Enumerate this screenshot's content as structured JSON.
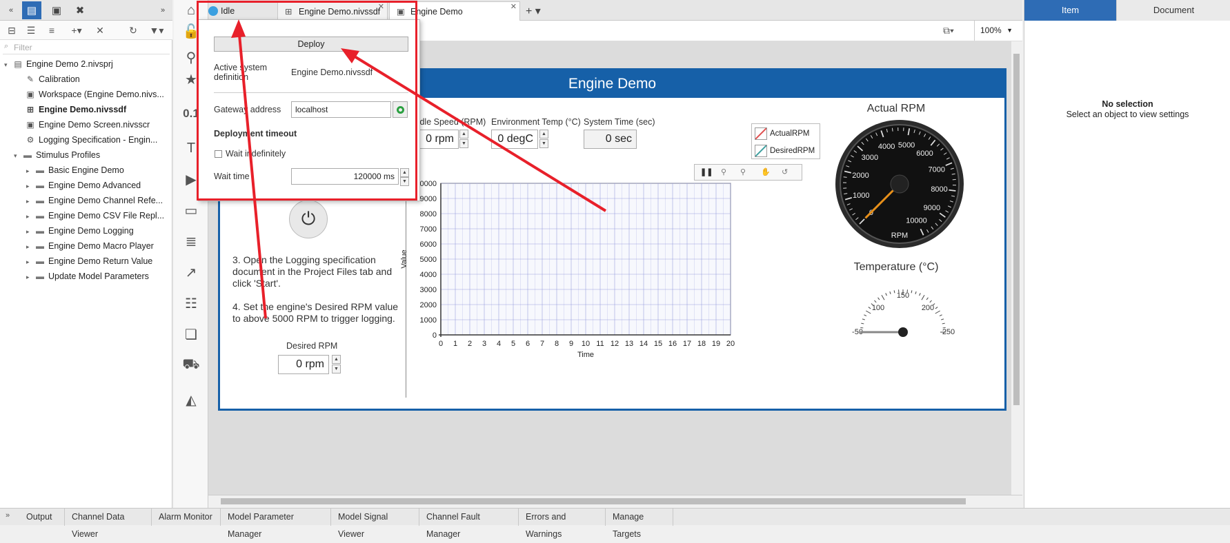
{
  "project": {
    "filter_placeholder": "Filter",
    "tree": [
      {
        "label": "Engine Demo 2.nivsprj",
        "bold": false
      },
      {
        "label": "Calibration",
        "bold": false
      },
      {
        "label": "Workspace (Engine Demo.nivs...",
        "bold": false
      },
      {
        "label": "Engine Demo.nivssdf",
        "bold": true
      },
      {
        "label": "Engine Demo Screen.nivsscr",
        "bold": false
      },
      {
        "label": "Logging Specification - Engin...",
        "bold": false
      },
      {
        "label": "Stimulus Profiles",
        "bold": false
      },
      {
        "label": "Basic Engine Demo",
        "bold": false
      },
      {
        "label": "Engine Demo Advanced",
        "bold": false
      },
      {
        "label": "Engine Demo Channel Refe...",
        "bold": false
      },
      {
        "label": "Engine Demo CSV File Repl...",
        "bold": false
      },
      {
        "label": "Engine Demo Logging",
        "bold": false
      },
      {
        "label": "Engine Demo Macro Player",
        "bold": false
      },
      {
        "label": "Engine Demo Return Value",
        "bold": false
      },
      {
        "label": "Update Model Parameters",
        "bold": false
      }
    ]
  },
  "tabs": {
    "idle": "Idle",
    "doc1": "Engine Demo.nivssdf",
    "doc2": "Engine Demo Screen.nivsscr",
    "zoom": "100%"
  },
  "toolbar_side": {
    "value_text": "0.1"
  },
  "popup": {
    "deploy": "Deploy",
    "active_label": "Active system definition",
    "active_value": "Engine Demo.nivssdf",
    "gateway_label": "Gateway address",
    "gateway_value": "localhost",
    "timeout_heading": "Deployment timeout",
    "wait_indef": "Wait indefinitely",
    "wait_time_label": "Wait time",
    "wait_time_value": "120000 ms"
  },
  "screen": {
    "title": "Engine Demo",
    "idle_speed_label": "Idle Speed (RPM)",
    "idle_speed_value": "0 rpm",
    "env_temp_label": "Environment Temp (°C)",
    "env_temp_value": "0 degC",
    "sys_time_label": "System Time (sec)",
    "sys_time_value": "0 sec",
    "instr3": "3. Open the Logging specification document in the Project Files tab and click 'Start'.",
    "instr4": "4. Set the engine's Desired RPM value to above 5000 RPM to trigger logging.",
    "desired_rpm_label": "Desired RPM",
    "desired_rpm_value": "0 rpm",
    "gauge_title": "Actual RPM",
    "gauge_unit": "RPM",
    "gauge_ticks": [
      "0",
      "1000",
      "2000",
      "3000",
      "4000",
      "5000",
      "6000",
      "7000",
      "8000",
      "9000",
      "10000"
    ],
    "gauge_value": 0,
    "temp_title": "Temperature (°C)",
    "temp_ticks": [
      "-50",
      "100",
      "150",
      "200",
      "250"
    ],
    "temp_value": -50
  },
  "chart_data": {
    "type": "line",
    "xlabel": "Time",
    "ylabel": "Value",
    "xlim": [
      0,
      20
    ],
    "ylim": [
      0,
      10000
    ],
    "x_ticks": [
      0,
      1,
      2,
      3,
      4,
      5,
      6,
      7,
      8,
      9,
      10,
      11,
      12,
      13,
      14,
      15,
      16,
      17,
      18,
      19,
      20
    ],
    "y_ticks": [
      0,
      1000,
      2000,
      3000,
      4000,
      5000,
      6000,
      7000,
      8000,
      9000,
      10000
    ],
    "grid": true,
    "legend_position": "top-right",
    "series": [
      {
        "name": "ActualRPM",
        "color": "#e05050",
        "x": [],
        "y": []
      },
      {
        "name": "DesiredRPM",
        "color": "#40a0a0",
        "x": [],
        "y": []
      }
    ]
  },
  "right_panel": {
    "tab_item": "Item",
    "tab_document": "Document",
    "no_selection": "No selection",
    "hint": "Select an object to view settings"
  },
  "bottom_tabs": [
    "Output",
    "Channel Data Viewer",
    "Alarm Monitor",
    "Model Parameter Manager",
    "Model Signal Viewer",
    "Channel Fault Manager",
    "Errors and Warnings",
    "Manage Targets"
  ],
  "colors": {
    "accent": "#2e6cb5",
    "panel_blue": "#1660a8",
    "annotation_red": "#e8202a"
  }
}
